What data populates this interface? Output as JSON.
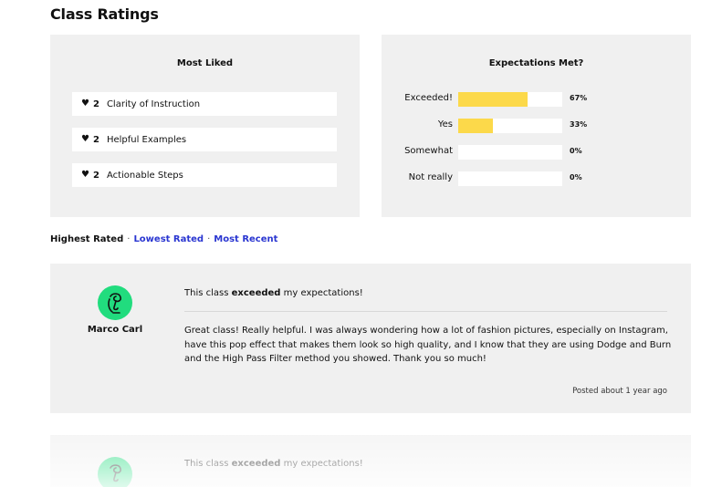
{
  "page": {
    "title": "Class Ratings"
  },
  "most_liked": {
    "title": "Most Liked",
    "items": [
      {
        "count": "2",
        "label": "Clarity of Instruction"
      },
      {
        "count": "2",
        "label": "Helpful Examples"
      },
      {
        "count": "2",
        "label": "Actionable Steps"
      }
    ]
  },
  "expectations": {
    "title": "Expectations Met?",
    "accent_color": "#fcd94a",
    "rows": [
      {
        "label": "Exceeded!",
        "percent_text": "67%",
        "value": 67
      },
      {
        "label": "Yes",
        "percent_text": "33%",
        "value": 33
      },
      {
        "label": "Somewhat",
        "percent_text": "0%",
        "value": 0
      },
      {
        "label": "Not really",
        "percent_text": "0%",
        "value": 0
      }
    ]
  },
  "sort": {
    "active": "Highest Rated",
    "separator": "·",
    "options": [
      "Lowest Rated",
      "Most Recent"
    ],
    "link_color": "#2a36d1"
  },
  "reviews": [
    {
      "author": "Marco Carl",
      "headline_prefix": "This class ",
      "headline_bold": "exceeded",
      "headline_suffix": " my expectations!",
      "body": "Great class! Really helpful. I was always wondering how a lot of fashion pictures, especially on Instagram, have this pop effect that makes them look so high quality, and I know that they are using Dodge and Burn and the High Pass Filter method you showed. Thank you so much!",
      "posted": "Posted about 1 year ago",
      "avatar_color": "#21dc7e"
    },
    {
      "headline_prefix": "This class ",
      "headline_bold": "exceeded",
      "headline_suffix": " my expectations!",
      "avatar_color": "#21dc7e"
    }
  ]
}
